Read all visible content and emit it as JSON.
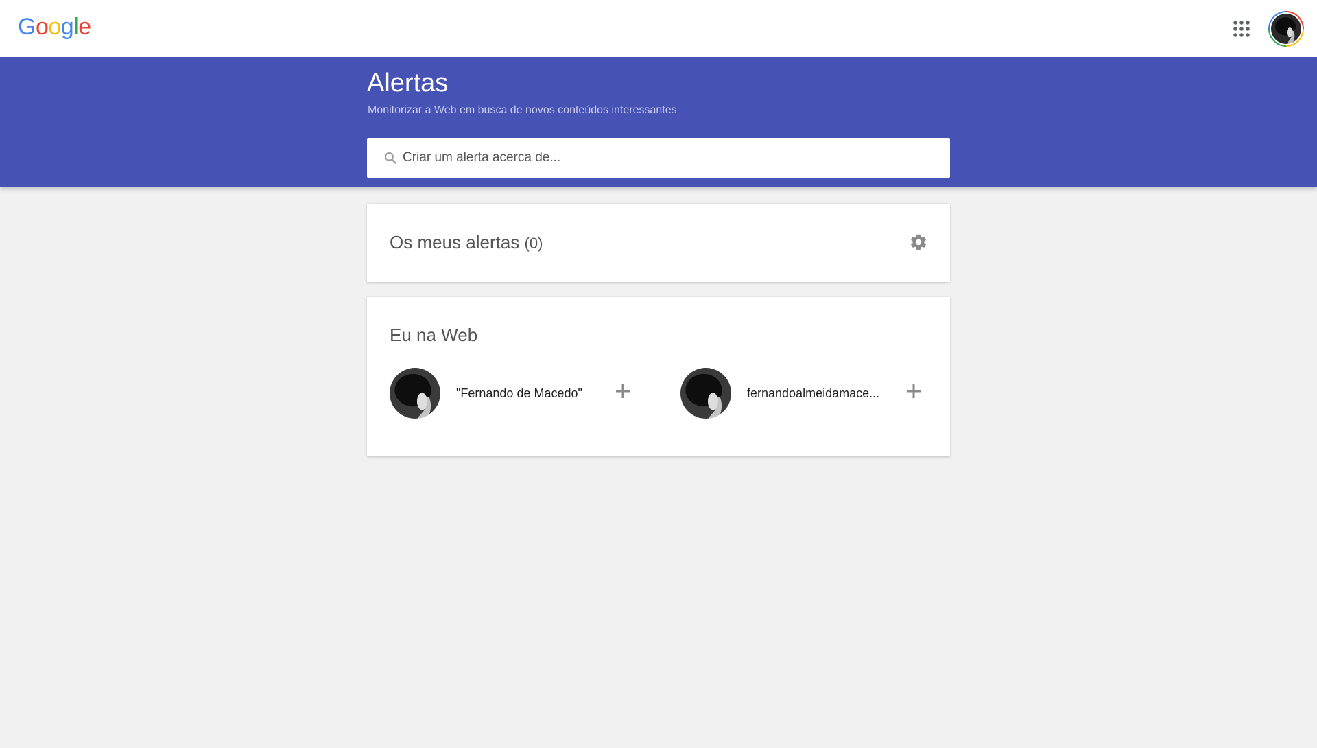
{
  "header": {
    "logo_letters": [
      {
        "char": "G",
        "color": "#4285f4"
      },
      {
        "char": "o",
        "color": "#ea4335"
      },
      {
        "char": "o",
        "color": "#fbbc05"
      },
      {
        "char": "g",
        "color": "#4285f4"
      },
      {
        "char": "l",
        "color": "#34a853"
      },
      {
        "char": "e",
        "color": "#ea4335"
      }
    ],
    "apps_icon": "apps-grid-icon",
    "account_icon": "account-avatar"
  },
  "hero": {
    "title": "Alertas",
    "subtitle": "Monitorizar a Web em busca de novos conteúdos interessantes",
    "search_placeholder": "Criar um alerta acerca de...",
    "background": "#4752b5"
  },
  "my_alerts": {
    "title": "Os meus alertas",
    "count": "(0)",
    "settings_icon": "gear-icon"
  },
  "me_on_web": {
    "title": "Eu na Web",
    "items": [
      {
        "label": "\"Fernando de Macedo\"",
        "action_icon": "plus-icon"
      },
      {
        "label": "fernandoalmeidamace...",
        "action_icon": "plus-icon"
      }
    ]
  }
}
